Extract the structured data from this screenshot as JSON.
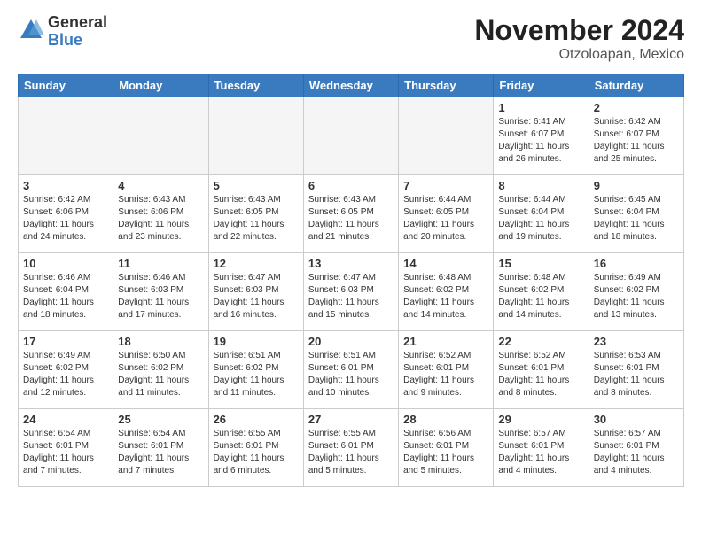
{
  "logo": {
    "general": "General",
    "blue": "Blue"
  },
  "header": {
    "month": "November 2024",
    "location": "Otzoloapan, Mexico"
  },
  "weekdays": [
    "Sunday",
    "Monday",
    "Tuesday",
    "Wednesday",
    "Thursday",
    "Friday",
    "Saturday"
  ],
  "weeks": [
    [
      {
        "day": "",
        "info": ""
      },
      {
        "day": "",
        "info": ""
      },
      {
        "day": "",
        "info": ""
      },
      {
        "day": "",
        "info": ""
      },
      {
        "day": "",
        "info": ""
      },
      {
        "day": "1",
        "info": "Sunrise: 6:41 AM\nSunset: 6:07 PM\nDaylight: 11 hours and 26 minutes."
      },
      {
        "day": "2",
        "info": "Sunrise: 6:42 AM\nSunset: 6:07 PM\nDaylight: 11 hours and 25 minutes."
      }
    ],
    [
      {
        "day": "3",
        "info": "Sunrise: 6:42 AM\nSunset: 6:06 PM\nDaylight: 11 hours and 24 minutes."
      },
      {
        "day": "4",
        "info": "Sunrise: 6:43 AM\nSunset: 6:06 PM\nDaylight: 11 hours and 23 minutes."
      },
      {
        "day": "5",
        "info": "Sunrise: 6:43 AM\nSunset: 6:05 PM\nDaylight: 11 hours and 22 minutes."
      },
      {
        "day": "6",
        "info": "Sunrise: 6:43 AM\nSunset: 6:05 PM\nDaylight: 11 hours and 21 minutes."
      },
      {
        "day": "7",
        "info": "Sunrise: 6:44 AM\nSunset: 6:05 PM\nDaylight: 11 hours and 20 minutes."
      },
      {
        "day": "8",
        "info": "Sunrise: 6:44 AM\nSunset: 6:04 PM\nDaylight: 11 hours and 19 minutes."
      },
      {
        "day": "9",
        "info": "Sunrise: 6:45 AM\nSunset: 6:04 PM\nDaylight: 11 hours and 18 minutes."
      }
    ],
    [
      {
        "day": "10",
        "info": "Sunrise: 6:46 AM\nSunset: 6:04 PM\nDaylight: 11 hours and 18 minutes."
      },
      {
        "day": "11",
        "info": "Sunrise: 6:46 AM\nSunset: 6:03 PM\nDaylight: 11 hours and 17 minutes."
      },
      {
        "day": "12",
        "info": "Sunrise: 6:47 AM\nSunset: 6:03 PM\nDaylight: 11 hours and 16 minutes."
      },
      {
        "day": "13",
        "info": "Sunrise: 6:47 AM\nSunset: 6:03 PM\nDaylight: 11 hours and 15 minutes."
      },
      {
        "day": "14",
        "info": "Sunrise: 6:48 AM\nSunset: 6:02 PM\nDaylight: 11 hours and 14 minutes."
      },
      {
        "day": "15",
        "info": "Sunrise: 6:48 AM\nSunset: 6:02 PM\nDaylight: 11 hours and 14 minutes."
      },
      {
        "day": "16",
        "info": "Sunrise: 6:49 AM\nSunset: 6:02 PM\nDaylight: 11 hours and 13 minutes."
      }
    ],
    [
      {
        "day": "17",
        "info": "Sunrise: 6:49 AM\nSunset: 6:02 PM\nDaylight: 11 hours and 12 minutes."
      },
      {
        "day": "18",
        "info": "Sunrise: 6:50 AM\nSunset: 6:02 PM\nDaylight: 11 hours and 11 minutes."
      },
      {
        "day": "19",
        "info": "Sunrise: 6:51 AM\nSunset: 6:02 PM\nDaylight: 11 hours and 11 minutes."
      },
      {
        "day": "20",
        "info": "Sunrise: 6:51 AM\nSunset: 6:01 PM\nDaylight: 11 hours and 10 minutes."
      },
      {
        "day": "21",
        "info": "Sunrise: 6:52 AM\nSunset: 6:01 PM\nDaylight: 11 hours and 9 minutes."
      },
      {
        "day": "22",
        "info": "Sunrise: 6:52 AM\nSunset: 6:01 PM\nDaylight: 11 hours and 8 minutes."
      },
      {
        "day": "23",
        "info": "Sunrise: 6:53 AM\nSunset: 6:01 PM\nDaylight: 11 hours and 8 minutes."
      }
    ],
    [
      {
        "day": "24",
        "info": "Sunrise: 6:54 AM\nSunset: 6:01 PM\nDaylight: 11 hours and 7 minutes."
      },
      {
        "day": "25",
        "info": "Sunrise: 6:54 AM\nSunset: 6:01 PM\nDaylight: 11 hours and 7 minutes."
      },
      {
        "day": "26",
        "info": "Sunrise: 6:55 AM\nSunset: 6:01 PM\nDaylight: 11 hours and 6 minutes."
      },
      {
        "day": "27",
        "info": "Sunrise: 6:55 AM\nSunset: 6:01 PM\nDaylight: 11 hours and 5 minutes."
      },
      {
        "day": "28",
        "info": "Sunrise: 6:56 AM\nSunset: 6:01 PM\nDaylight: 11 hours and 5 minutes."
      },
      {
        "day": "29",
        "info": "Sunrise: 6:57 AM\nSunset: 6:01 PM\nDaylight: 11 hours and 4 minutes."
      },
      {
        "day": "30",
        "info": "Sunrise: 6:57 AM\nSunset: 6:01 PM\nDaylight: 11 hours and 4 minutes."
      }
    ]
  ]
}
